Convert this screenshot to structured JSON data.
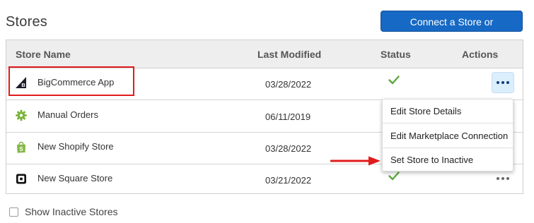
{
  "page": {
    "title": "Stores",
    "connect_button_label": "Connect a Store or Marketplace"
  },
  "table": {
    "headers": {
      "store_name": "Store Name",
      "last_modified": "Last Modified",
      "status": "Status",
      "actions": "Actions"
    },
    "rows": [
      {
        "name": "BigCommerce App",
        "last_modified": "03/28/2022",
        "status": "active",
        "icon": "bigcommerce-icon"
      },
      {
        "name": "Manual Orders",
        "last_modified": "06/11/2019",
        "status": "active",
        "icon": "gear-icon"
      },
      {
        "name": "New Shopify Store",
        "last_modified": "03/28/2022",
        "status": "active",
        "icon": "shopify-icon"
      },
      {
        "name": "New Square Store",
        "last_modified": "03/21/2022",
        "status": "active",
        "icon": "square-icon"
      }
    ]
  },
  "actions_menu": {
    "items": [
      "Edit Store Details",
      "Edit Marketplace Connection",
      "Set Store to Inactive"
    ]
  },
  "footer": {
    "show_inactive_label": "Show Inactive Stores",
    "show_inactive_checked": false
  },
  "colors": {
    "primary_button": "#1669c4",
    "check_green": "#5aa83d",
    "annotation_red": "#e11b1b",
    "menu_active_bg": "#dbeefc"
  }
}
